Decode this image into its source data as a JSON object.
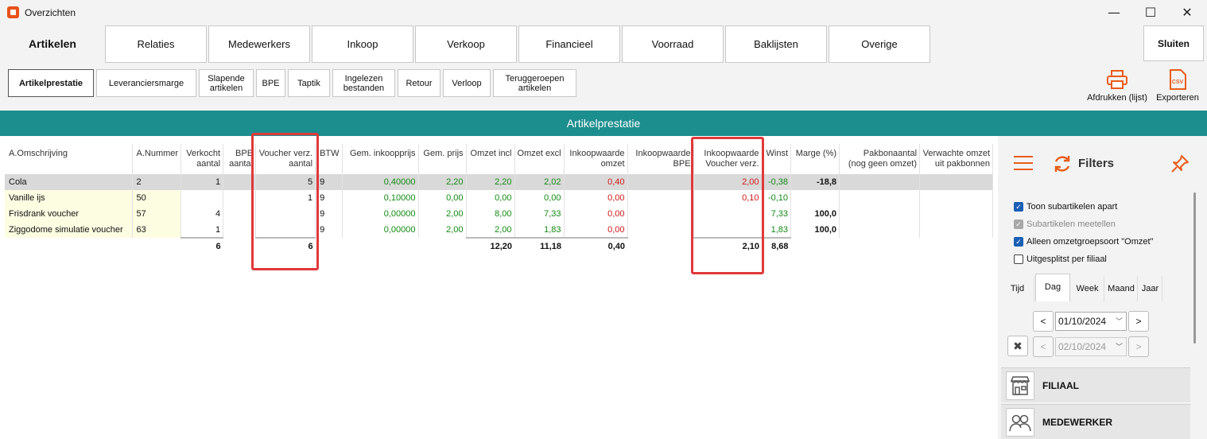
{
  "window": {
    "title": "Overzichten",
    "minimize": "—",
    "maximize": "☐",
    "close": "✕"
  },
  "main_tabs": {
    "active": "Artikelen",
    "items": [
      "Relaties",
      "Medewerkers",
      "Inkoop",
      "Verkoop",
      "Financieel",
      "Voorraad",
      "Baklijsten",
      "Overige"
    ],
    "close_label": "Sluiten"
  },
  "sub_tabs": {
    "active": "Artikelprestatie",
    "items": [
      "Leveranciersmarge",
      "Slapende\nartikelen",
      "BPE",
      "Taptik",
      "Ingelezen\nbestanden",
      "Retour",
      "Verloop",
      "Teruggeroepen\nartikelen"
    ]
  },
  "toolbar": {
    "print_label": "Afdrukken (lijst)",
    "export_label": "Exporteren",
    "export_icon_text": "CSV"
  },
  "banner_title": "Artikelprestatie",
  "grid": {
    "columns": [
      "A.Omschrijving",
      "A.Nummer",
      "Verkocht\naantal",
      "BPE\naantal",
      "Voucher verz.\naantal",
      "BTW",
      "Gem. inkoopprijs",
      "Gem. prijs",
      "Omzet incl",
      "Omzet excl",
      "Inkoopwaarde\nomzet",
      "Inkoopwaarde\nBPE",
      "Inkoopwaarde\nVoucher verz.",
      "Winst",
      "Marge (%)",
      "Pakbonaantal\n(nog geen omzet)",
      "Verwachte omzet\nuit pakbonnen"
    ],
    "rows": [
      [
        "Cola",
        "2",
        "1",
        "",
        "5",
        "9",
        "0,40000",
        "2,20",
        "2,20",
        "2,02",
        "0,40",
        "",
        "2,00",
        "-0,38",
        "-18,8",
        "",
        ""
      ],
      [
        "Vanille ijs",
        "50",
        "",
        "",
        "1",
        "9",
        "0,10000",
        "0,00",
        "0,00",
        "0,00",
        "0,00",
        "",
        "0,10",
        "-0,10",
        "",
        "",
        ""
      ],
      [
        "Frisdrank voucher",
        "57",
        "4",
        "",
        "",
        "9",
        "0,00000",
        "2,00",
        "8,00",
        "7,33",
        "0,00",
        "",
        "",
        "7,33",
        "100,0",
        "",
        ""
      ],
      [
        "Ziggodome simulatie voucher",
        "63",
        "1",
        "",
        "",
        "9",
        "0,00000",
        "2,00",
        "2,00",
        "1,83",
        "0,00",
        "",
        "",
        "1,83",
        "100,0",
        "",
        ""
      ]
    ],
    "totals": [
      "",
      "",
      "6",
      "",
      "6",
      "",
      "",
      "",
      "12,20",
      "11,18",
      "0,40",
      "",
      "2,10",
      "8,68",
      "",
      "",
      ""
    ]
  },
  "filters": {
    "title": "Filters",
    "checkboxes": [
      {
        "label": "Toon subartikelen apart",
        "checked": true,
        "disabled": false
      },
      {
        "label": "Subartikelen meetellen",
        "checked": true,
        "disabled": true
      },
      {
        "label": "Alleen omzetgroepsoort \"Omzet\"",
        "checked": true,
        "disabled": false
      },
      {
        "label": "Uitgesplitst per filiaal",
        "checked": false,
        "disabled": false
      }
    ],
    "period_tabs": [
      "Tijd",
      "Dag",
      "Week",
      "Maand",
      "Jaar"
    ],
    "active_period": "Dag",
    "date_from": "01/10/2024",
    "date_to": "02/10/2024",
    "prev": "<",
    "next": ">",
    "clear": "✖",
    "sections": [
      "FILIAAL",
      "MEDEWERKER"
    ]
  },
  "colors": {
    "accent": "#e85d1a",
    "banner": "#1d8e8e",
    "highlight": "#e0393b",
    "positive": "#128a12",
    "negative": "#d01818"
  }
}
